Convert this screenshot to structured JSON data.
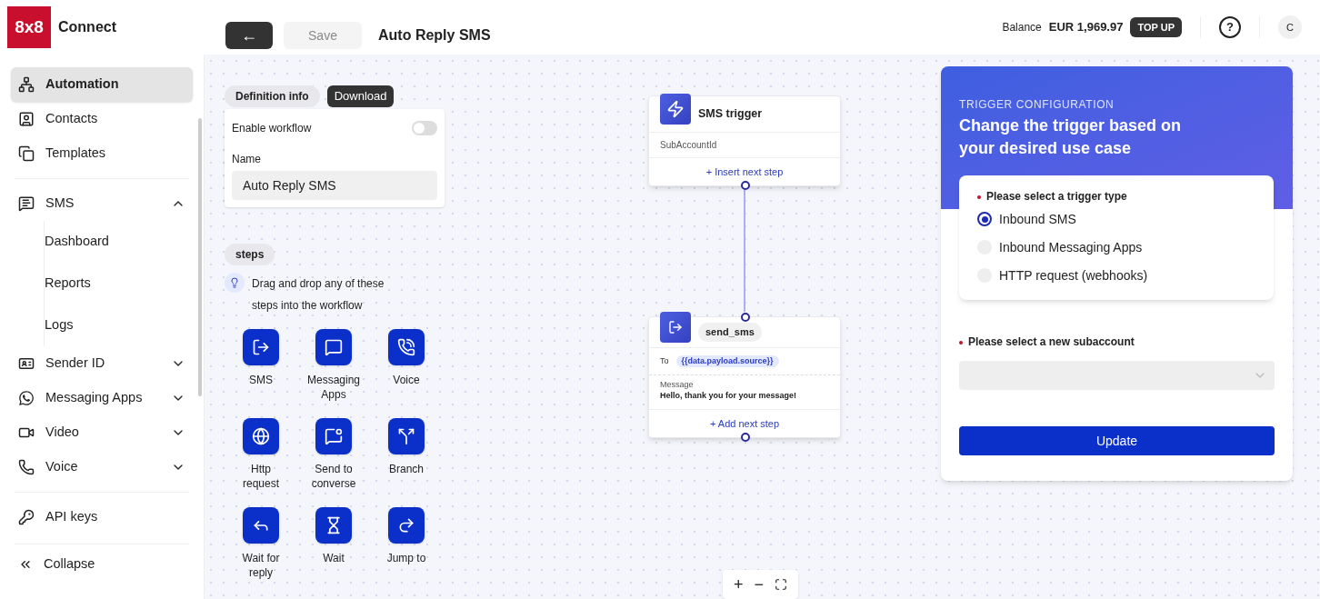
{
  "brand": {
    "logo": "8x8",
    "name": "Connect"
  },
  "toolbar": {
    "back": "←",
    "save": {
      "label": "Save",
      "disabled": true
    },
    "title": "Auto Reply SMS"
  },
  "account": {
    "balance_label": "Balance",
    "balance": "EUR 1,969.97",
    "top_up": "TOP UP",
    "help": "?",
    "avatar": "C"
  },
  "sidebar": {
    "items": [
      {
        "label": "Automation",
        "kind": "link",
        "selected": true
      },
      {
        "label": "Contacts",
        "kind": "link",
        "selected": false
      },
      {
        "label": "Templates",
        "kind": "link",
        "selected": false
      },
      {
        "label": "SMS",
        "kind": "group",
        "selected": false,
        "expanded": true,
        "children": [
          {
            "label": "Dashboard",
            "selected": false
          },
          {
            "label": "Reports",
            "selected": false
          },
          {
            "label": "Logs",
            "selected": false
          }
        ]
      },
      {
        "label": "Sender ID",
        "kind": "group",
        "selected": false,
        "expanded": false
      },
      {
        "label": "Messaging Apps",
        "kind": "group",
        "selected": false,
        "expanded": false
      },
      {
        "label": "Video",
        "kind": "group",
        "selected": false,
        "expanded": false
      },
      {
        "label": "Voice",
        "kind": "group",
        "selected": false,
        "expanded": false
      },
      {
        "label": "API keys",
        "kind": "link",
        "selected": false
      }
    ],
    "collapse": "Collapse"
  },
  "definition": {
    "tab": "Definition info",
    "download": "Download",
    "enable_label": "Enable workflow",
    "enabled": false,
    "name_label": "Name",
    "name_value": "Auto Reply SMS"
  },
  "steps": {
    "title": "steps",
    "hint": "Drag and drop any of these steps into the workflow",
    "items": [
      {
        "label": "SMS"
      },
      {
        "label": "Messaging Apps"
      },
      {
        "label": "Voice"
      },
      {
        "label": "Http request"
      },
      {
        "label": "Send to converse"
      },
      {
        "label": "Branch"
      },
      {
        "label": "Wait for reply"
      },
      {
        "label": "Wait"
      },
      {
        "label": "Jump to"
      }
    ]
  },
  "nodes": [
    {
      "kind": "trigger",
      "title": "SMS trigger",
      "field": "SubAccountId",
      "action": "+ Insert next step"
    },
    {
      "kind": "send",
      "title": "send_sms",
      "to_label": "To",
      "to_value": "{{data.payload.source}}",
      "message_label": "Message",
      "message": "Hello, thank you for your message!",
      "action": "+ Add next step"
    }
  ],
  "zoom_controls": [
    "+",
    "−"
  ],
  "trigger_config": {
    "eyebrow": "TRIGGER CONFIGURATION",
    "heading": "Change the trigger based on your desired use case",
    "type_label": "Please select a trigger type",
    "options": [
      {
        "label": "Inbound SMS",
        "selected": true
      },
      {
        "label": "Inbound Messaging Apps",
        "selected": false
      },
      {
        "label": "HTTP request (webhooks)",
        "selected": false
      }
    ],
    "subaccount_label": "Please select a new subaccount",
    "update": "Update"
  }
}
